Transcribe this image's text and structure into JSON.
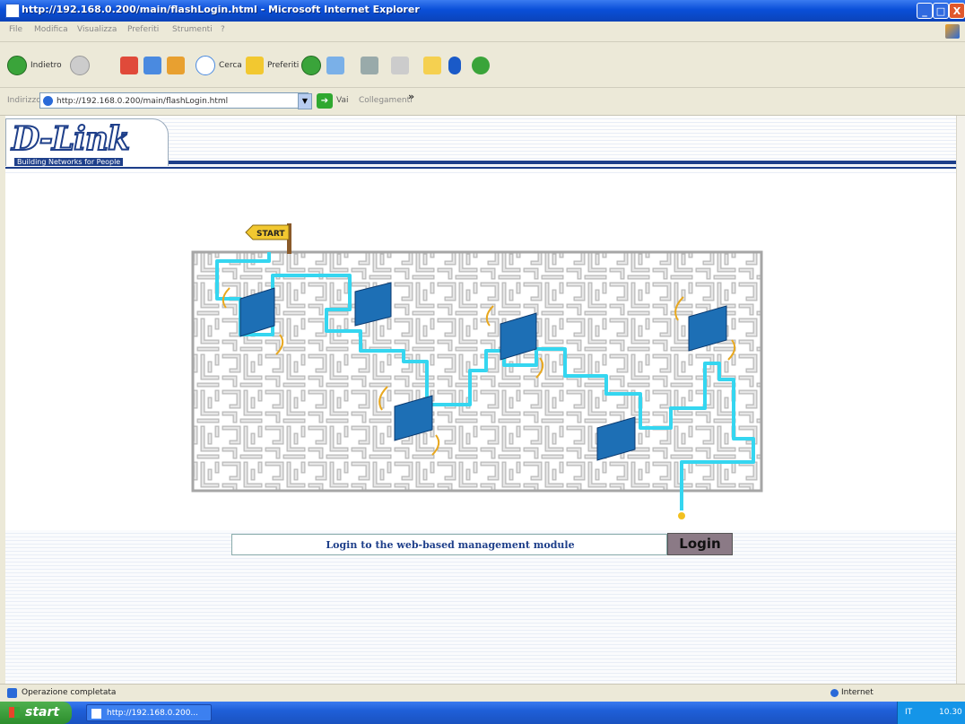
{
  "window": {
    "title": "http://192.168.0.200/main/flashLogin.html - Microsoft Internet Explorer",
    "min_label": "_",
    "max_label": "□",
    "close_label": "X"
  },
  "menubar": {
    "items": [
      "File",
      "Modifica",
      "Visualizza",
      "Preferiti",
      "Strumenti",
      "?"
    ]
  },
  "toolbar": {
    "back_label": "Indietro",
    "search_label": "Cerca",
    "favorites_label": "Preferiti"
  },
  "address": {
    "label": "Indirizzo",
    "url": "http://192.168.0.200/main/flashLogin.html",
    "go_label": "Vai",
    "links_label": "Collegamenti",
    "more": "»"
  },
  "brand": {
    "logo": "D-Link",
    "tagline": "Building Networks for People"
  },
  "maze": {
    "start_label": "START"
  },
  "login": {
    "text": "Login to the web-based management module",
    "button": "Login"
  },
  "status": {
    "text": "Operazione completata",
    "zone": "Internet"
  },
  "taskbar": {
    "start": "start",
    "task": "http://192.168.0.200...",
    "lang": "IT",
    "time": "10.30"
  },
  "colors": {
    "path": "#35d6f0",
    "router": "#1d6fb5",
    "brand": "#1e3f8a",
    "login_button": "#8b7a86"
  }
}
